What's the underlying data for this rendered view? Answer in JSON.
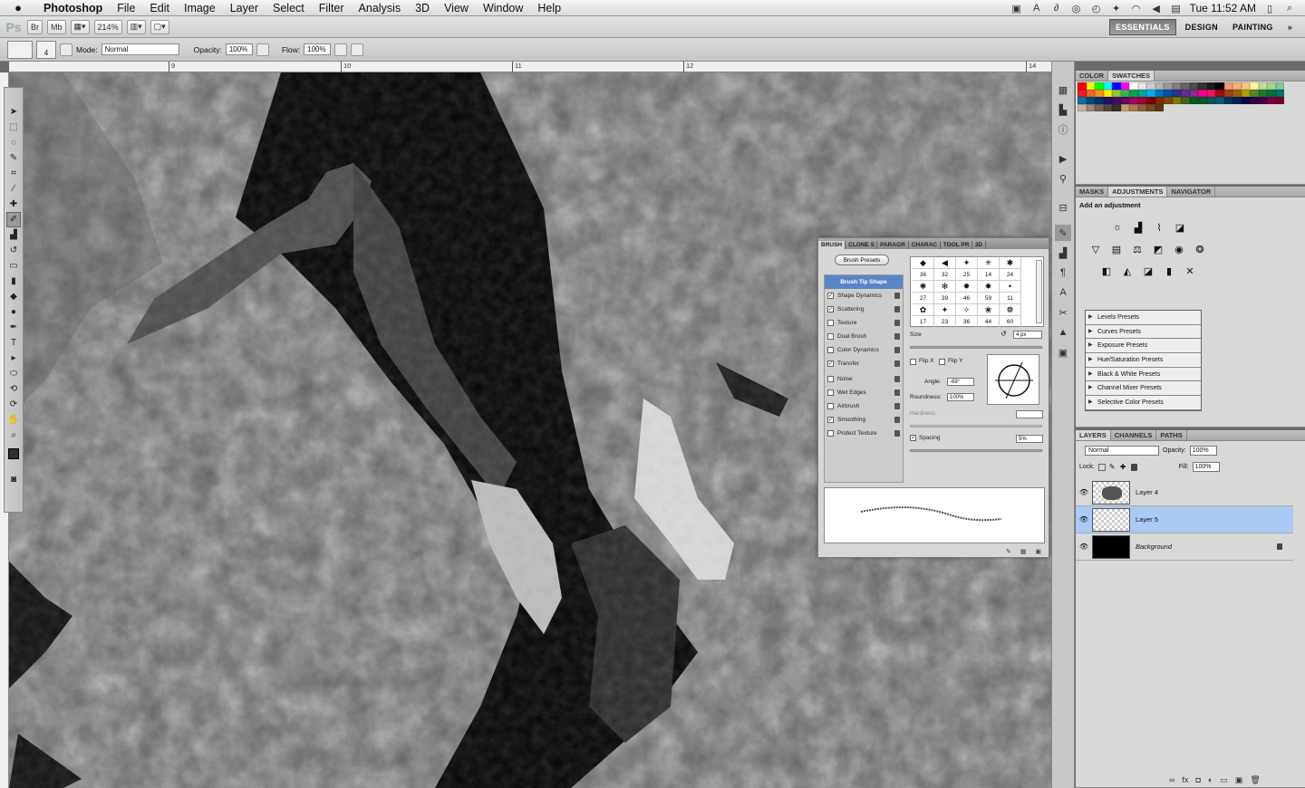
{
  "menubar": {
    "app": "Photoshop",
    "items": [
      "File",
      "Edit",
      "Image",
      "Layer",
      "Select",
      "Filter",
      "Analysis",
      "3D",
      "View",
      "Window",
      "Help"
    ],
    "clock": "Tue 11:52 AM"
  },
  "appbar": {
    "logo": "Ps",
    "zoom": "214%",
    "workspaces": [
      "ESSENTIALS",
      "DESIGN",
      "PAINTING"
    ],
    "active_workspace": "ESSENTIALS",
    "more": "»"
  },
  "options": {
    "brush_size": "4",
    "mode_label": "Mode:",
    "mode_value": "Normal",
    "opacity_label": "Opacity:",
    "opacity_value": "100%",
    "flow_label": "Flow:",
    "flow_value": "100%"
  },
  "ruler": {
    "ticks": [
      "9",
      "10",
      "11",
      "12",
      "14"
    ]
  },
  "swatches_panel": {
    "tabs": [
      "COLOR",
      "SWATCHES"
    ],
    "active": "SWATCHES",
    "colors": [
      "#ff0000",
      "#ffff00",
      "#00ff00",
      "#00ffff",
      "#0000ff",
      "#ff00ff",
      "#ffffff",
      "#e6e6e6",
      "#cccccc",
      "#b3b3b3",
      "#999999",
      "#808080",
      "#666666",
      "#4d4d4d",
      "#333333",
      "#1a1a1a",
      "#000000",
      "#f7977a",
      "#f9ad81",
      "#fdc68a",
      "#fff79a",
      "#c4df9b",
      "#a2d39c",
      "#82ca9d",
      "#ed1c24",
      "#f26522",
      "#f7941d",
      "#fff200",
      "#8dc63f",
      "#39b54a",
      "#00a651",
      "#00a99d",
      "#00aeef",
      "#0072bc",
      "#0054a6",
      "#2e3192",
      "#662d91",
      "#92278f",
      "#ec008c",
      "#ed145b",
      "#9e0b0f",
      "#a0410d",
      "#a36209",
      "#aba000",
      "#598527",
      "#1a7b30",
      "#007236",
      "#00746b",
      "#0076a3",
      "#004a80",
      "#003471",
      "#1b1464",
      "#440e62",
      "#630460",
      "#9e005d",
      "#9e0039",
      "#790000",
      "#7b2e00",
      "#7d4900",
      "#827b00",
      "#406618",
      "#005e20",
      "#005826",
      "#005952",
      "#005b7f",
      "#003663",
      "#002157",
      "#0d004c",
      "#32004b",
      "#4b0049",
      "#7b0046",
      "#7a0026",
      "#c7b299",
      "#998675",
      "#736357",
      "#534741",
      "#37302a",
      "#c69c6d",
      "#a67c52",
      "#8c6239",
      "#754c24",
      "#603913"
    ]
  },
  "adjustments_panel": {
    "tabs": [
      "MASKS",
      "ADJUSTMENTS",
      "NAVIGATOR"
    ],
    "active": "ADJUSTMENTS",
    "title": "Add an adjustment",
    "presets": [
      "Levels Presets",
      "Curves Presets",
      "Exposure Presets",
      "Hue/Saturation Presets",
      "Black & White Presets",
      "Channel Mixer Presets",
      "Selective Color Presets"
    ]
  },
  "layers_panel": {
    "tabs": [
      "LAYERS",
      "CHANNELS",
      "PATHS"
    ],
    "active": "LAYERS",
    "blend": "Normal",
    "opacity_label": "Opacity:",
    "opacity": "100%",
    "lock_label": "Lock:",
    "fill_label": "Fill:",
    "fill": "100%",
    "layers": [
      {
        "name": "Layer 4",
        "selected": false
      },
      {
        "name": "Layer 5",
        "selected": true
      },
      {
        "name": "Background",
        "selected": false
      }
    ]
  },
  "brush_panel": {
    "tabs": [
      "BRUSH",
      "CLONE S",
      "PARAGR",
      "CHARAC",
      "TOOL PR",
      "3D"
    ],
    "active": "BRUSH",
    "presets_button": "Brush Presets",
    "options": [
      {
        "label": "Brush Tip Shape",
        "head": true
      },
      {
        "label": "Shape Dynamics",
        "checked": true
      },
      {
        "label": "Scattering",
        "checked": true
      },
      {
        "label": "Texture",
        "checked": false
      },
      {
        "label": "Dual Brush",
        "checked": false
      },
      {
        "label": "Color Dynamics",
        "checked": false
      },
      {
        "label": "Transfer",
        "checked": true
      },
      {
        "label": "Noise",
        "checked": false
      },
      {
        "label": "Wet Edges",
        "checked": false
      },
      {
        "label": "Airbrush",
        "checked": false
      },
      {
        "label": "Smoothing",
        "checked": true
      },
      {
        "label": "Protect Texture",
        "checked": false
      }
    ],
    "tip_sizes": [
      "36",
      "32",
      "25",
      "14",
      "24",
      "27",
      "39",
      "46",
      "59",
      "11",
      "17",
      "23",
      "36",
      "44",
      "60"
    ],
    "size_label": "Size",
    "size_value": "4 px",
    "flip_x": "Flip X",
    "flip_y": "Flip Y",
    "angle_label": "Angle:",
    "angle_value": "-69°",
    "roundness_label": "Roundness:",
    "roundness_value": "100%",
    "hardness_label": "Hardness",
    "spacing_label": "Spacing",
    "spacing_value": "5%"
  }
}
